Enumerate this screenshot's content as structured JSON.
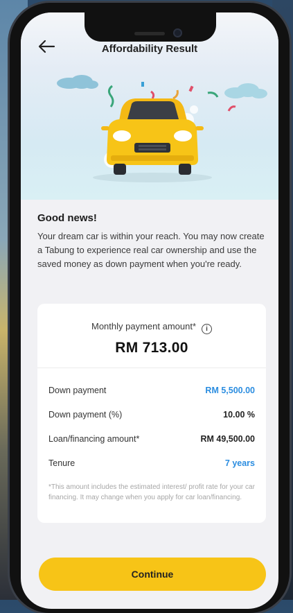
{
  "header": {
    "title": "Affordability Result"
  },
  "colors": {
    "accent": "#f7c417",
    "link_blue": "#2b8de0"
  },
  "message": {
    "headline": "Good news!",
    "body": "Your dream car is within your reach. You may now create a Tabung to experience real car ownership and use the saved money as down payment when you're ready."
  },
  "summary": {
    "monthly_label": "Monthly payment amount*",
    "monthly_value": "RM 713.00",
    "rows": [
      {
        "label": "Down payment",
        "value": "RM 5,500.00"
      },
      {
        "label": "Down payment (%)",
        "value": "10.00 %"
      },
      {
        "label": "Loan/financing amount*",
        "value": "RM 49,500.00"
      },
      {
        "label": "Tenure",
        "value": "7 years"
      }
    ],
    "footnote": "*This amount includes the estimated interest/ profit rate for your car financing. It may change when you apply for car loan/financing."
  },
  "actions": {
    "continue_label": "Continue"
  }
}
